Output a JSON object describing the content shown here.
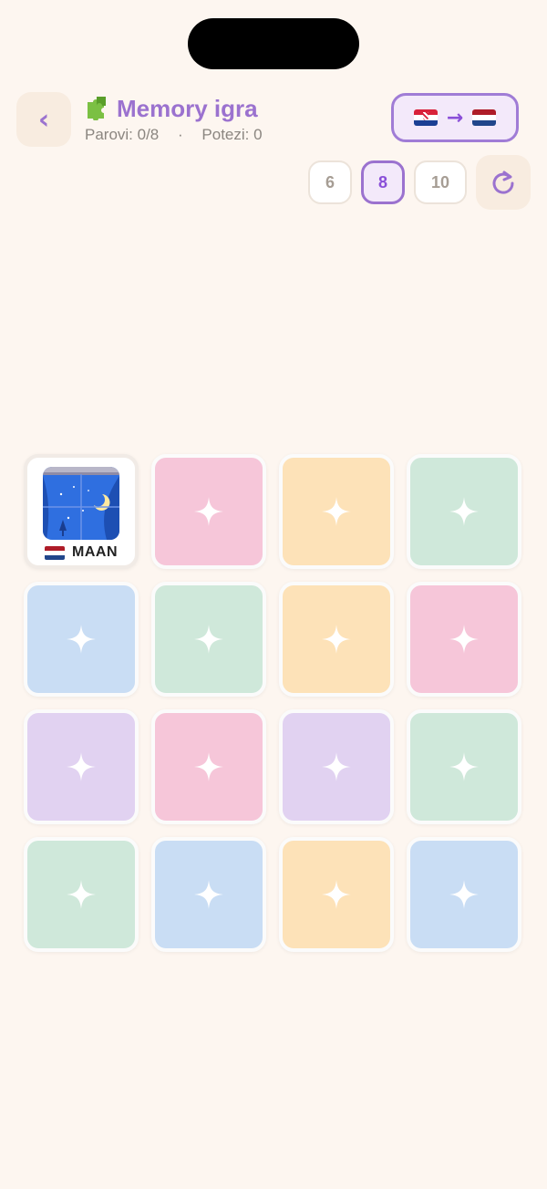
{
  "header": {
    "back_label": "‹",
    "title": "Memory igra",
    "icon": "puzzle-icon",
    "stats": {
      "pairs_label": "Parovi: 0/8",
      "separator": "·",
      "moves_label": "Potezi: 0"
    },
    "language": {
      "from": "hr-flag",
      "to": "nl-flag",
      "arrow": "→"
    }
  },
  "size_options": [
    {
      "label": "6",
      "active": false
    },
    {
      "label": "8",
      "active": true
    },
    {
      "label": "10",
      "active": false
    }
  ],
  "refresh_icon": "refresh-icon",
  "cards": [
    {
      "color": "white",
      "revealed": true,
      "word": "MAAN",
      "image": "moon-window-image"
    },
    {
      "color": "#f6c6d9"
    },
    {
      "color": "#fde2b8"
    },
    {
      "color": "#cfe8da"
    },
    {
      "color": "#c9ddf4"
    },
    {
      "color": "#cfe8da"
    },
    {
      "color": "#fde2b8"
    },
    {
      "color": "#f6c6d9"
    },
    {
      "color": "#e1d2f1"
    },
    {
      "color": "#f6c6d9"
    },
    {
      "color": "#e1d2f1"
    },
    {
      "color": "#cfe8da"
    },
    {
      "color": "#cfe8da"
    },
    {
      "color": "#c9ddf4"
    },
    {
      "color": "#fde2b8"
    },
    {
      "color": "#c9ddf4"
    }
  ],
  "colors": {
    "accent": "#9b72cf",
    "background": "#fdf6f0"
  }
}
